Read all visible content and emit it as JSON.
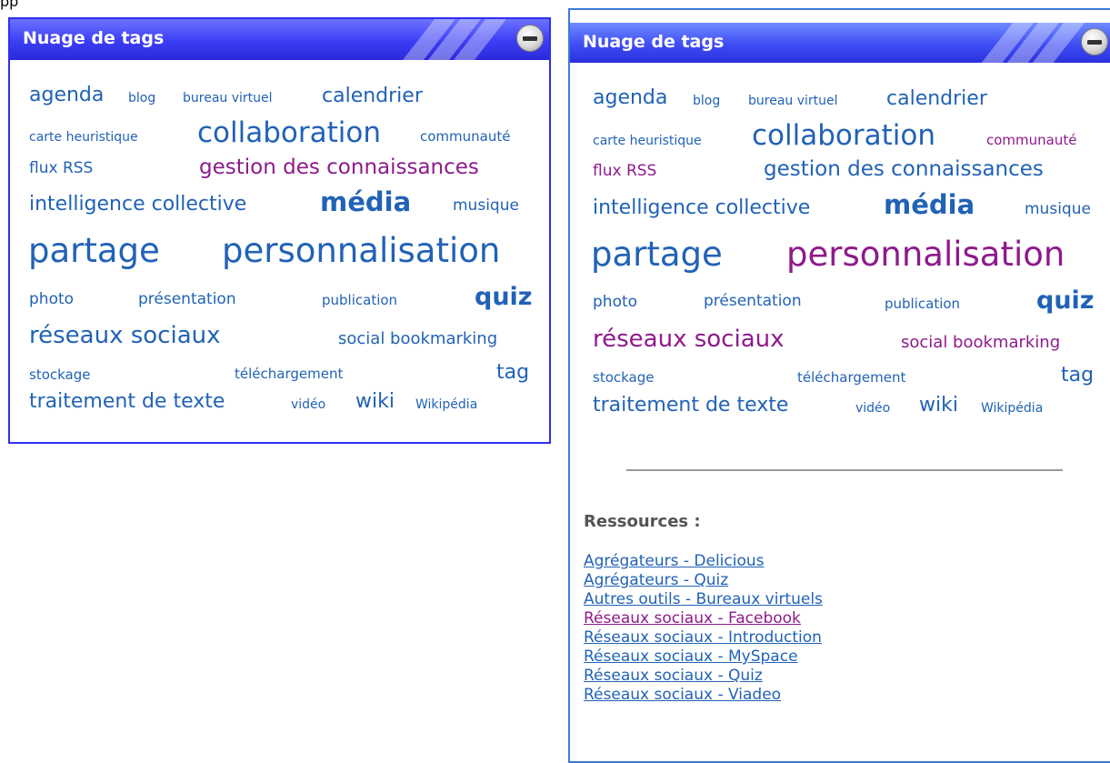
{
  "panel_title": "Nuage de tags",
  "tags": [
    {
      "label": "agenda"
    },
    {
      "label": "blog"
    },
    {
      "label": "bureau virtuel"
    },
    {
      "label": "calendrier"
    },
    {
      "label": "carte heuristique"
    },
    {
      "label": "collaboration"
    },
    {
      "label": "communauté"
    },
    {
      "label": "flux RSS"
    },
    {
      "label": "gestion des connaissances"
    },
    {
      "label": "intelligence collective"
    },
    {
      "label": "média"
    },
    {
      "label": "musique"
    },
    {
      "label": "partage"
    },
    {
      "label": "personnalisation"
    },
    {
      "label": "photo"
    },
    {
      "label": "présentation"
    },
    {
      "label": "publication"
    },
    {
      "label": "quiz"
    },
    {
      "label": "réseaux sociaux"
    },
    {
      "label": "social bookmarking"
    },
    {
      "label": "stockage"
    },
    {
      "label": "téléchargement"
    },
    {
      "label": "tag"
    },
    {
      "label": "traitement de texte"
    },
    {
      "label": "vidéo"
    },
    {
      "label": "wiki"
    },
    {
      "label": "Wikipédia"
    }
  ],
  "resources": {
    "title": "Ressources :",
    "links": [
      "Agrégateurs - Delicious",
      "Agrégateurs - Quiz",
      "Autres outils - Bureaux virtuels",
      "Réseaux sociaux - Facebook",
      "Réseaux sociaux - Introduction",
      "Réseaux sociaux - MySpace",
      "Réseaux sociaux - Quiz",
      "Réseaux sociaux - Viadeo"
    ]
  },
  "colors": {
    "tag_blue": "#2162b6",
    "tag_visited": "#8e1a8c",
    "header": "#3b3df5"
  }
}
